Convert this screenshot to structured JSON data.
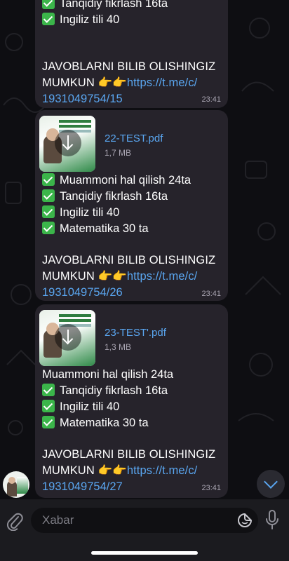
{
  "colors": {
    "accent": "#5aa6f0",
    "bubble": "#26232b",
    "check": "#3bb54a"
  },
  "messages": [
    {
      "partial": true,
      "lines": [
        "Tanqidiy fikrlash 16ta",
        "Ingiliz tili 40"
      ],
      "cta_line1": "JAVOBLARNI BILIB OLISHINGIZ",
      "cta_line2": "MUMKUN",
      "emoji": "👉👉",
      "link_part1": "https://t.me/c/",
      "link_part2": "1931049754/15",
      "time": "23:41"
    },
    {
      "file_name": "22-TEST.pdf",
      "file_size": "1,7 MB",
      "lines": [
        "Muammoni hal qilish 24ta",
        "Tanqidiy fikrlash 16ta",
        "Ingiliz tili 40",
        "Matematika 30 ta"
      ],
      "cta_line1": "JAVOBLARNI BILIB OLISHINGIZ",
      "cta_line2": "MUMKUN",
      "emoji": "👉👉",
      "link_part1": "https://t.me/c/",
      "link_part2": "1931049754/26",
      "time": "23:41"
    },
    {
      "file_name": "23-TEST'.pdf",
      "file_size": "1,3 MB",
      "first_line": "Muammoni hal qilish 24ta",
      "lines": [
        "Tanqidiy fikrlash 16ta",
        "Ingiliz tili 40",
        "Matematika 30 ta"
      ],
      "cta_line1": "JAVOBLARNI BILIB OLISHINGIZ",
      "cta_line2": "MUMKUN",
      "emoji": "👉👉",
      "link_part1": "https://t.me/c/",
      "link_part2": "1931049754/27",
      "time": "23:41"
    }
  ],
  "input": {
    "placeholder": "Xabar",
    "value": ""
  },
  "icons": {
    "attach": "paperclip-icon",
    "sticker": "sticker-icon",
    "mic": "microphone-icon",
    "scroll": "chevron-down-icon",
    "download": "download-arrow-icon"
  }
}
